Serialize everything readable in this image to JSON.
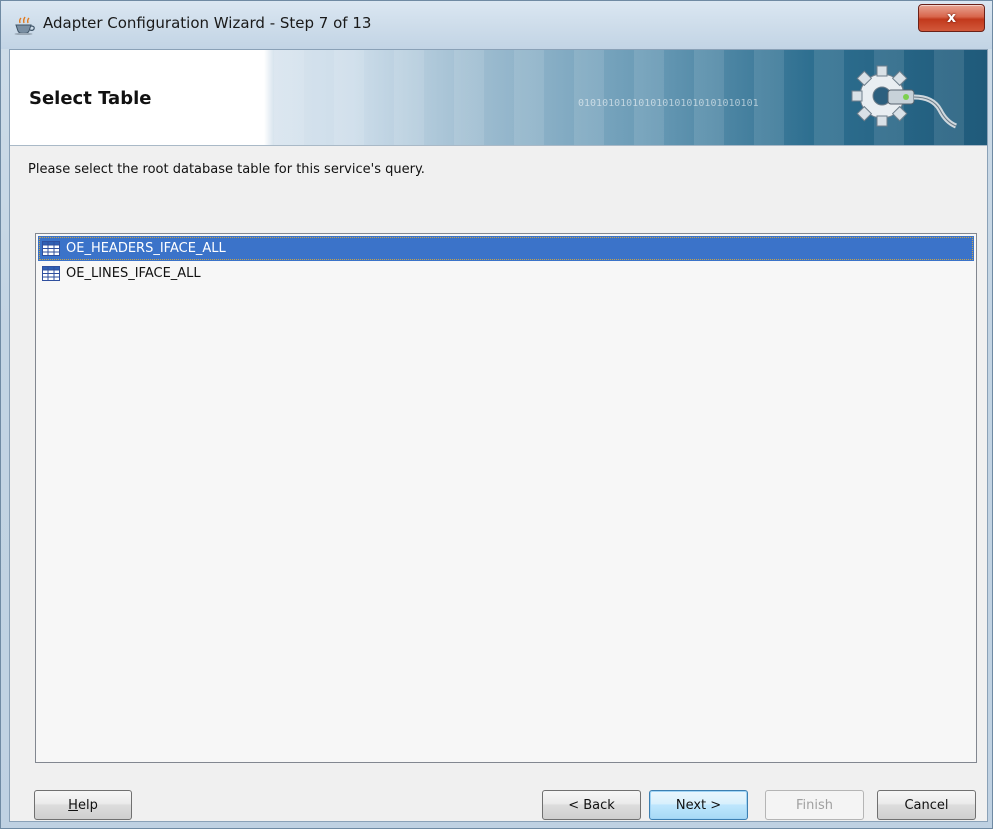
{
  "window": {
    "title": "Adapter Configuration Wizard - Step 7 of 13",
    "close_label": "x"
  },
  "banner": {
    "title": "Select Table",
    "binary_decor": "010101010101010101010101010101"
  },
  "instruction": "Please select the root database table for this service's query.",
  "tables": [
    {
      "name": "OE_HEADERS_IFACE_ALL",
      "selected": true
    },
    {
      "name": "OE_LINES_IFACE_ALL",
      "selected": false
    }
  ],
  "buttons": {
    "help": {
      "label": "Help",
      "mnemonic": "H"
    },
    "back": {
      "label": "< Back",
      "mnemonic": "B"
    },
    "next": {
      "label": "Next >",
      "mnemonic": "N"
    },
    "finish": {
      "label": "Finish",
      "mnemonic": "F",
      "enabled": false
    },
    "cancel": {
      "label": "Cancel"
    }
  },
  "colors": {
    "selection": "#3b73c9",
    "banner_dark": "#1f5a7a",
    "close_red": "#c2391c"
  },
  "icons": {
    "app": "coffee-cup-icon",
    "banner": "gear-plug-icon",
    "table": "table-grid-icon"
  }
}
